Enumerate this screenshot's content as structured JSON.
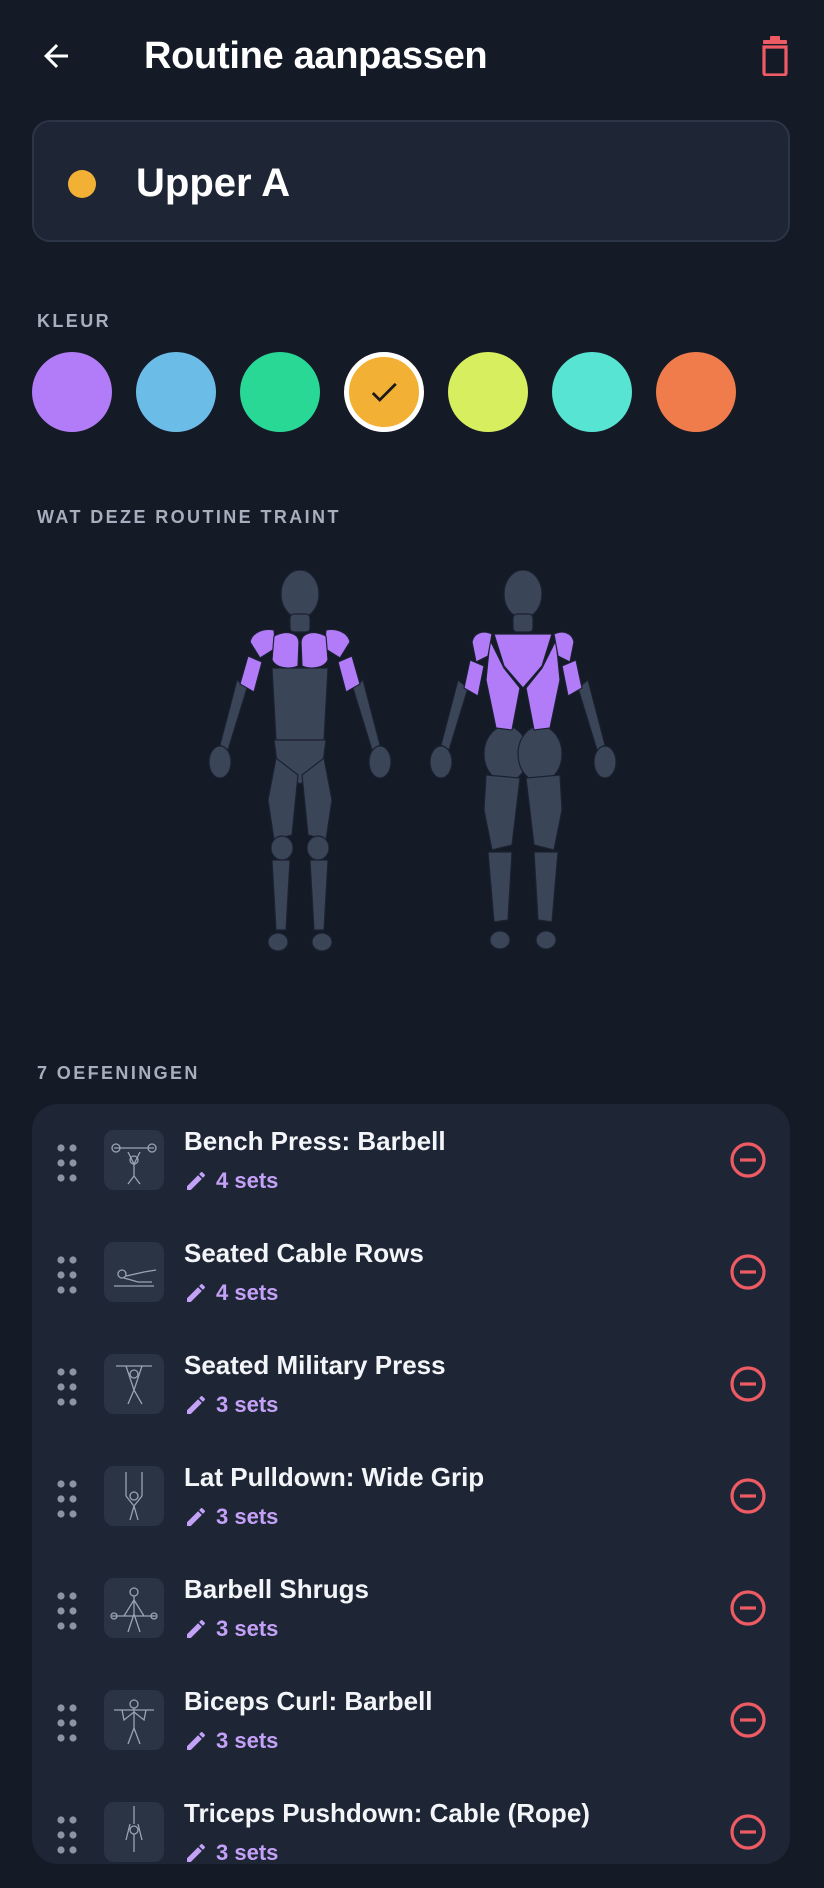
{
  "header": {
    "title": "Routine aanpassen",
    "back_icon": "arrow-left-icon",
    "delete_icon": "trash-icon",
    "delete_color": "#ef5b64"
  },
  "routine": {
    "name": "Upper A",
    "color": "#f2b134"
  },
  "color_section": {
    "label": "KLEUR",
    "swatches": [
      {
        "color": "#b27cf8",
        "selected": false
      },
      {
        "color": "#6bbde8",
        "selected": false
      },
      {
        "color": "#2ad896",
        "selected": false
      },
      {
        "color": "#f2b134",
        "selected": true
      },
      {
        "color": "#d7ee5f",
        "selected": false
      },
      {
        "color": "#58e4d2",
        "selected": false
      },
      {
        "color": "#f07c4c",
        "selected": false
      }
    ]
  },
  "muscles_section": {
    "label": "WAT DEZE ROUTINE TRAINT",
    "highlight_color": "#b27cf8",
    "base_color": "#3b4558"
  },
  "exercises_section": {
    "label": "7 OEFENINGEN",
    "items": [
      {
        "name": "Bench Press: Barbell",
        "sets": "4 sets"
      },
      {
        "name": "Seated Cable Rows",
        "sets": "4 sets"
      },
      {
        "name": "Seated Military Press",
        "sets": "3 sets"
      },
      {
        "name": "Lat Pulldown: Wide Grip",
        "sets": "3 sets"
      },
      {
        "name": "Barbell Shrugs",
        "sets": "3 sets"
      },
      {
        "name": "Biceps Curl: Barbell",
        "sets": "3 sets"
      },
      {
        "name": "Triceps Pushdown: Cable (Rope)",
        "sets": "3 sets"
      }
    ],
    "accent_color": "#c4a1f7",
    "remove_color": "#ef5b64"
  }
}
